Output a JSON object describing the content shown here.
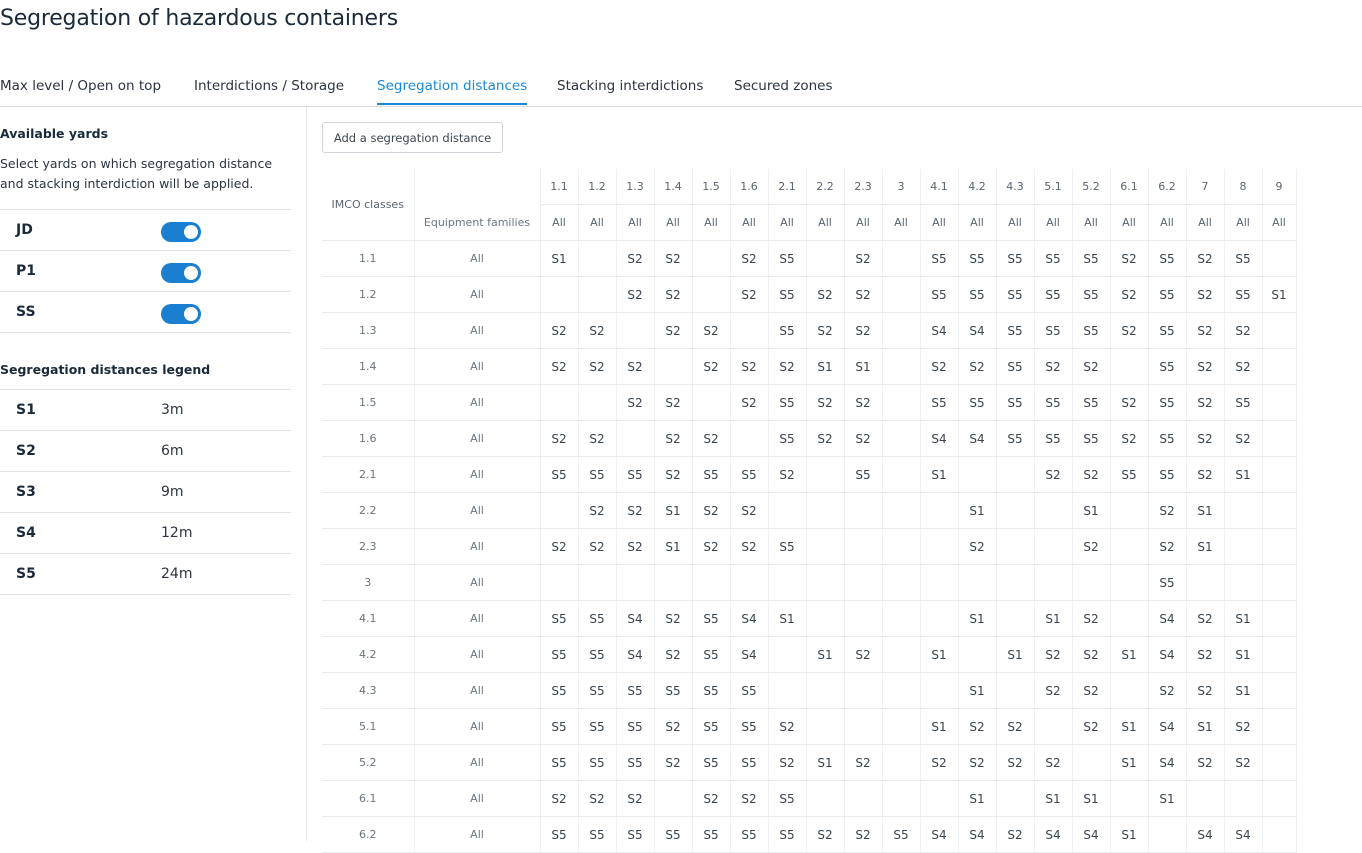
{
  "page": {
    "title": "Segregation of hazardous containers"
  },
  "tabs": [
    {
      "label": "Max level / Open on top",
      "active": false
    },
    {
      "label": "Interdictions / Storage",
      "active": false
    },
    {
      "label": "Segregation distances",
      "active": true
    },
    {
      "label": "Stacking interdictions",
      "active": false
    },
    {
      "label": "Secured zones",
      "active": false
    }
  ],
  "yards": {
    "title": "Available yards",
    "description": "Select yards on which segregation distance and stacking interdiction will be applied.",
    "items": [
      {
        "name": "JD",
        "enabled": true
      },
      {
        "name": "P1",
        "enabled": true
      },
      {
        "name": "SS",
        "enabled": true
      }
    ]
  },
  "legend": {
    "title": "Segregation distances legend",
    "items": [
      {
        "key": "S1",
        "value": "3m"
      },
      {
        "key": "S2",
        "value": "6m"
      },
      {
        "key": "S3",
        "value": "9m"
      },
      {
        "key": "S4",
        "value": "12m"
      },
      {
        "key": "S5",
        "value": "24m"
      }
    ]
  },
  "toolbar": {
    "add_label": "Add a segregation distance"
  },
  "table": {
    "imco_label": "IMCO classes",
    "family_label": "Equipment families",
    "columns": [
      "1.1",
      "1.2",
      "1.3",
      "1.4",
      "1.5",
      "1.6",
      "2.1",
      "2.2",
      "2.3",
      "3",
      "4.1",
      "4.2",
      "4.3",
      "5.1",
      "5.2",
      "6.1",
      "6.2",
      "7",
      "8",
      "9"
    ],
    "column_families": [
      "All",
      "All",
      "All",
      "All",
      "All",
      "All",
      "All",
      "All",
      "All",
      "All",
      "All",
      "All",
      "All",
      "All",
      "All",
      "All",
      "All",
      "All",
      "All",
      "All"
    ],
    "rows": [
      {
        "cls": "1.1",
        "family": "All",
        "cells": [
          "S1",
          "",
          "S2",
          "S2",
          "",
          "S2",
          "S5",
          "",
          "S2",
          "",
          "S5",
          "S5",
          "S5",
          "S5",
          "S5",
          "S2",
          "S5",
          "S2",
          "S5",
          ""
        ]
      },
      {
        "cls": "1.2",
        "family": "All",
        "cells": [
          "",
          "",
          "S2",
          "S2",
          "",
          "S2",
          "S5",
          "S2",
          "S2",
          "",
          "S5",
          "S5",
          "S5",
          "S5",
          "S5",
          "S2",
          "S5",
          "S2",
          "S5",
          "S1"
        ]
      },
      {
        "cls": "1.3",
        "family": "All",
        "cells": [
          "S2",
          "S2",
          "",
          "S2",
          "S2",
          "",
          "S5",
          "S2",
          "S2",
          "",
          "S4",
          "S4",
          "S5",
          "S5",
          "S5",
          "S2",
          "S5",
          "S2",
          "S2",
          ""
        ]
      },
      {
        "cls": "1.4",
        "family": "All",
        "cells": [
          "S2",
          "S2",
          "S2",
          "",
          "S2",
          "S2",
          "S2",
          "S1",
          "S1",
          "",
          "S2",
          "S2",
          "S5",
          "S2",
          "S2",
          "",
          "S5",
          "S2",
          "S2",
          ""
        ]
      },
      {
        "cls": "1.5",
        "family": "All",
        "cells": [
          "",
          "",
          "S2",
          "S2",
          "",
          "S2",
          "S5",
          "S2",
          "S2",
          "",
          "S5",
          "S5",
          "S5",
          "S5",
          "S5",
          "S2",
          "S5",
          "S2",
          "S5",
          ""
        ]
      },
      {
        "cls": "1.6",
        "family": "All",
        "cells": [
          "S2",
          "S2",
          "",
          "S2",
          "S2",
          "",
          "S5",
          "S2",
          "S2",
          "",
          "S4",
          "S4",
          "S5",
          "S5",
          "S5",
          "S2",
          "S5",
          "S2",
          "S2",
          ""
        ]
      },
      {
        "cls": "2.1",
        "family": "All",
        "cells": [
          "S5",
          "S5",
          "S5",
          "S2",
          "S5",
          "S5",
          "S2",
          "",
          "S5",
          "",
          "S1",
          "",
          "",
          "S2",
          "S2",
          "S5",
          "S5",
          "S2",
          "S1",
          ""
        ]
      },
      {
        "cls": "2.2",
        "family": "All",
        "cells": [
          "",
          "S2",
          "S2",
          "S1",
          "S2",
          "S2",
          "",
          "",
          "",
          "",
          "",
          "S1",
          "",
          "",
          "S1",
          "",
          "S2",
          "S1",
          "",
          ""
        ]
      },
      {
        "cls": "2.3",
        "family": "All",
        "cells": [
          "S2",
          "S2",
          "S2",
          "S1",
          "S2",
          "S2",
          "S5",
          "",
          "",
          "",
          "",
          "S2",
          "",
          "",
          "S2",
          "",
          "S2",
          "S1",
          "",
          ""
        ]
      },
      {
        "cls": "3",
        "family": "All",
        "cells": [
          "",
          "",
          "",
          "",
          "",
          "",
          "",
          "",
          "",
          "",
          "",
          "",
          "",
          "",
          "",
          "",
          "S5",
          "",
          "",
          ""
        ]
      },
      {
        "cls": "4.1",
        "family": "All",
        "cells": [
          "S5",
          "S5",
          "S4",
          "S2",
          "S5",
          "S4",
          "S1",
          "",
          "",
          "",
          "",
          "S1",
          "",
          "S1",
          "S2",
          "",
          "S4",
          "S2",
          "S1",
          ""
        ]
      },
      {
        "cls": "4.2",
        "family": "All",
        "cells": [
          "S5",
          "S5",
          "S4",
          "S2",
          "S5",
          "S4",
          "",
          "S1",
          "S2",
          "",
          "S1",
          "",
          "S1",
          "S2",
          "S2",
          "S1",
          "S4",
          "S2",
          "S1",
          ""
        ]
      },
      {
        "cls": "4.3",
        "family": "All",
        "cells": [
          "S5",
          "S5",
          "S5",
          "S5",
          "S5",
          "S5",
          "",
          "",
          "",
          "",
          "",
          "S1",
          "",
          "S2",
          "S2",
          "",
          "S2",
          "S2",
          "S1",
          ""
        ]
      },
      {
        "cls": "5.1",
        "family": "All",
        "cells": [
          "S5",
          "S5",
          "S5",
          "S2",
          "S5",
          "S5",
          "S2",
          "",
          "",
          "",
          "S1",
          "S2",
          "S2",
          "",
          "S2",
          "S1",
          "S4",
          "S1",
          "S2",
          ""
        ]
      },
      {
        "cls": "5.2",
        "family": "All",
        "cells": [
          "S5",
          "S5",
          "S5",
          "S2",
          "S5",
          "S5",
          "S2",
          "S1",
          "S2",
          "",
          "S2",
          "S2",
          "S2",
          "S2",
          "",
          "S1",
          "S4",
          "S2",
          "S2",
          ""
        ]
      },
      {
        "cls": "6.1",
        "family": "All",
        "cells": [
          "S2",
          "S2",
          "S2",
          "",
          "S2",
          "S2",
          "S5",
          "",
          "",
          "",
          "",
          "S1",
          "",
          "S1",
          "S1",
          "",
          "S1",
          "",
          "",
          ""
        ]
      },
      {
        "cls": "6.2",
        "family": "All",
        "cells": [
          "S5",
          "S5",
          "S5",
          "S5",
          "S5",
          "S5",
          "S5",
          "S2",
          "S2",
          "S5",
          "S4",
          "S4",
          "S2",
          "S4",
          "S4",
          "S1",
          "",
          "S4",
          "S4",
          ""
        ]
      }
    ]
  }
}
